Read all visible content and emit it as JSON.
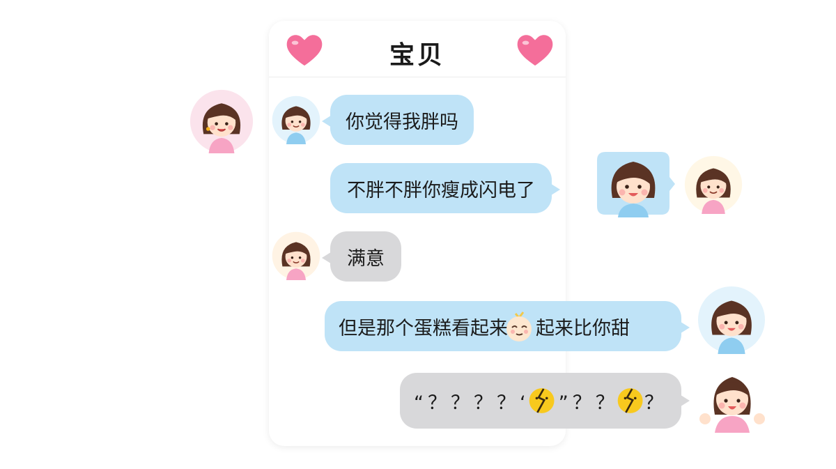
{
  "chat": {
    "title": "宝贝",
    "messages": [
      {
        "text": "你觉得我胖吗",
        "side": "left",
        "color": "blue"
      },
      {
        "text": "不胖不胖你瘦成闪电了",
        "side": "right",
        "color": "blue"
      },
      {
        "text": "满意",
        "side": "left",
        "color": "gray"
      },
      {
        "text_before": "但是那个蛋糕看起来",
        "text_after": "起来比你甜",
        "side": "right",
        "color": "blue"
      },
      {
        "text_before": "“？？？？‘",
        "text_middle": "”？？",
        "text_after": "？",
        "side": "right",
        "color": "gray"
      }
    ]
  },
  "icons": {
    "header_left": "heart-icon",
    "header_right": "heart-icon",
    "emoji_face": "smiling-face-emoji",
    "emoji_cracked": "cracked-face-emoji"
  },
  "colors": {
    "heart": "#f46e9a",
    "bubble_blue": "#bfe3f7",
    "bubble_gray": "#d8d8da",
    "hair": "#5a3324",
    "skin": "#ffe1cc",
    "shirt_blue": "#8fcdf0",
    "shirt_pink": "#f7a4c4"
  }
}
